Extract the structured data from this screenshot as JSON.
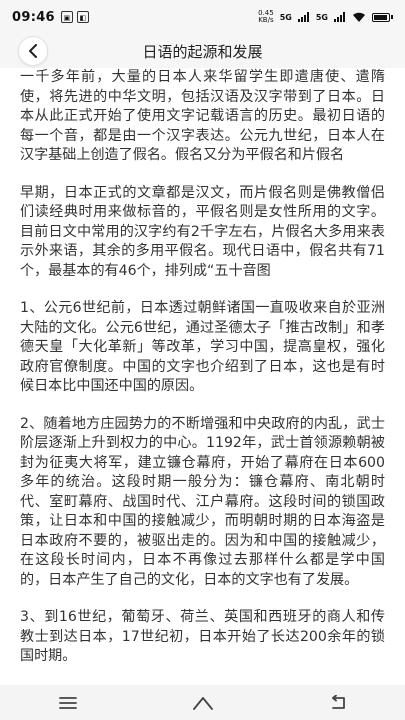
{
  "status_bar": {
    "time": "09:46",
    "net_speed": "0.45",
    "net_unit": "KB/s",
    "signal_1": "5G",
    "signal_2": "5G",
    "battery_percent": 90
  },
  "header": {
    "title": "日语的起源和发展"
  },
  "article": {
    "paragraphs": [
      "一千多年前，大量的日本人来华留学生即遣唐使、遣隋使，将先进的中华文明，包括汉语及汉字带到了日本。日本从此正式开始了使用文字记载语言的历史。最初日语的每一个音，都是由一个汉字表达。公元九世纪，日本人在汉字基础上创造了假名。假名又分为平假名和片假名",
      "早期，日本正式的文章都是汉文，而片假名则是佛教僧侣们读经典时用来做标音的，平假名则是女性所用的文字。目前日文中常用的汉字约有2千字左右，片假名大多用来表示外来语，其余的多用平假名。现代日语中，假名共有71个，最基本的有46个，排列成“五十音图",
      "1、公元6世纪前，日本透过朝鲜诸国一直吸收来自於亚洲大陆的文化。公元6世纪，通过圣德太子「推古改制」和孝德天皇「大化革新」等改革，学习中国，提高皇权，强化政府官僚制度。中国的文字也介绍到了日本，这也是有时候日本比中国还中国的原因。",
      "2、随着地方庄园势力的不断增强和中央政府的内乱，武士阶层逐渐上升到权力的中心。1192年，武士首领源赖朝被封为征夷大将军，建立镰仓幕府，开始了幕府在日本600多年的统治。这段时期一般分为：镰仓幕府、南北朝时代、室町幕府、战国时代、江户幕府。这段时间的锁国政策，让日本和中国的接触减少，而明朝时期的日本海盗是日本政府不要的，被驱出走的。因为和中国的接触减少，在这段长时间内，日本不再像过去那样什么都是学中国的，日本产生了自己的文化，日本的文字也有了发展。",
      "3、到16世纪，葡萄牙、荷兰、英国和西班牙的商人和传教士到达日本，17世纪初，日本开始了长达200余年的锁国时期。"
    ]
  },
  "icons": {
    "back": "chevron-left-icon",
    "nav_menu": "menu-icon",
    "nav_home": "home-icon",
    "nav_back": "return-icon"
  }
}
